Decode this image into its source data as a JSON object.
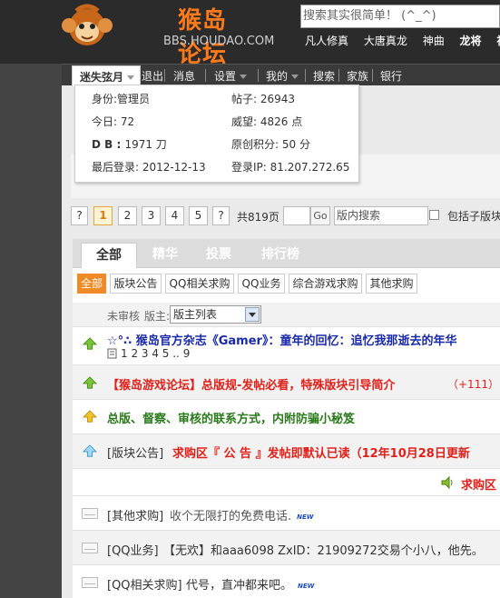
{
  "header": {
    "logo_text": "猴岛论坛",
    "logo_sub": "BBS.HOUDAO.COM",
    "search_placeholder": "搜索其实很简单！ (^_^)",
    "top_links": [
      "凡人修真",
      "大唐真龙",
      "神曲",
      "龙将",
      "神"
    ]
  },
  "nav": {
    "user": "迷失弦月",
    "items": [
      "退出",
      "消息",
      "设置",
      "我的",
      "搜索",
      "家族",
      "银行"
    ]
  },
  "user_popup": {
    "identity_label": "身份:",
    "identity": "管理员",
    "posts_label": "帖子:",
    "posts": "26943",
    "today_label": "今日:",
    "today": "72",
    "prestige_label": "威望:",
    "prestige": "4826 点",
    "db_label": "D B :",
    "db": "1971 刀",
    "orig_label": "原创积分:",
    "orig": "50 分",
    "last_login_label": "最后登录:",
    "last_login": "2012-12-13",
    "login_ip_label": "登录IP:",
    "login_ip": "81.207.272.65"
  },
  "pager": {
    "pages": [
      "?",
      "1",
      "2",
      "3",
      "4",
      "5",
      "?"
    ],
    "current": "1",
    "total": "共819页",
    "go": "Go",
    "search_placeholder": "版内搜索",
    "include_sub": "包括子版块"
  },
  "tabs": [
    "全部",
    "精华",
    "投票",
    "排行榜"
  ],
  "categories": [
    "全部",
    "版块公告",
    "QQ相关求购",
    "QQ业务",
    "综合游戏求购",
    "其他求购"
  ],
  "filter": {
    "unaudited": "未审核",
    "moderator_label": "版主:",
    "moderator_select": "版主列表"
  },
  "threads": [
    {
      "title": "☆°∴ 猴岛官方杂志《Gamer》：童年的回忆：追忆我那逝去的年华",
      "pages": "1 2 3 4 5 .. 9"
    },
    {
      "title": "【猴岛游戏论坛】总版规-发帖必看，特殊版块引导简介",
      "extra": "（+111）"
    },
    {
      "title": "总版、督察、审核的联系方式，内附防骗小秘笈"
    },
    {
      "prefix": "[版块公告]",
      "title": "求购区『 公 告 』发帖即默认已读（12年10月28日更新"
    },
    {
      "title": "求购区"
    },
    {
      "prefix": "[其他求购]",
      "title": "收个无限打的免费电话.",
      "new": "NEW"
    },
    {
      "prefix": "[QQ业务]",
      "title": "【无欢】和aaa6098 ZxID：21909272交易个小八，他先。"
    },
    {
      "prefix": "[QQ相关求购]",
      "title": "代号，直冲都来吧。",
      "new": "NEW"
    }
  ],
  "colors": {
    "brand_orange": "#f08a24",
    "thread_blue": "#1a2aa8",
    "thread_red": "#e0201a",
    "thread_green": "#2a7a1c"
  }
}
